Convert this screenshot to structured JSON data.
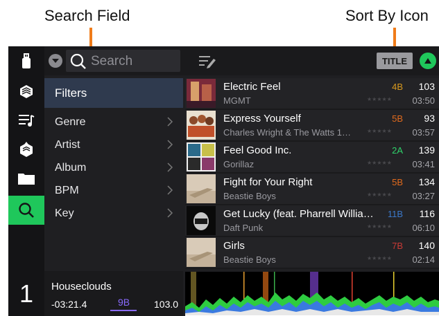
{
  "callouts": {
    "search_field": "Search Field",
    "sort_by_icon": "Sort By Icon"
  },
  "topbar": {
    "search_placeholder": "Search",
    "sort_label": "TITLE"
  },
  "filters": {
    "header": "Filters",
    "items": [
      {
        "label": "Genre"
      },
      {
        "label": "Artist"
      },
      {
        "label": "Album"
      },
      {
        "label": "BPM"
      },
      {
        "label": "Key"
      }
    ]
  },
  "deck": {
    "number": "1",
    "title": "Houseclouds",
    "time": "-03:21.4",
    "key": "9B",
    "bpm": "103.0"
  },
  "tracks": [
    {
      "title": "Electric Feel",
      "artist": "MGMT",
      "key": "4B",
      "key_color": "#d99a1e",
      "bpm": "103",
      "time": "03:50"
    },
    {
      "title": "Express Yourself",
      "artist": "Charles Wright & The Watts 1…",
      "key": "5B",
      "key_color": "#e06a1d",
      "bpm": "93",
      "time": "03:57"
    },
    {
      "title": "Feel Good Inc.",
      "artist": "Gorillaz",
      "key": "2A",
      "key_color": "#2fd36b",
      "bpm": "139",
      "time": "03:41"
    },
    {
      "title": "Fight for Your Right",
      "artist": "Beastie Boys",
      "key": "5B",
      "key_color": "#e06a1d",
      "bpm": "134",
      "time": "03:27"
    },
    {
      "title": "Get Lucky (feat. Pharrell Willia…",
      "artist": "Daft Punk",
      "key": "11B",
      "key_color": "#3b78c9",
      "bpm": "116",
      "time": "06:10"
    },
    {
      "title": "Girls",
      "artist": "Beastie Boys",
      "key": "7B",
      "key_color": "#c93a36",
      "bpm": "140",
      "time": "02:14"
    }
  ],
  "colors": {
    "accent_green": "#1fc75b",
    "callout_arrow": "#f07c1a",
    "deck_key": "#8a6bff"
  },
  "icons": [
    "usb-icon",
    "crate-icon",
    "playlist-icon",
    "prepare-icon",
    "folder-icon",
    "search-icon",
    "edit-playlist-icon",
    "chevron-down-icon",
    "chevron-right-icon",
    "sort-ascending-icon"
  ]
}
